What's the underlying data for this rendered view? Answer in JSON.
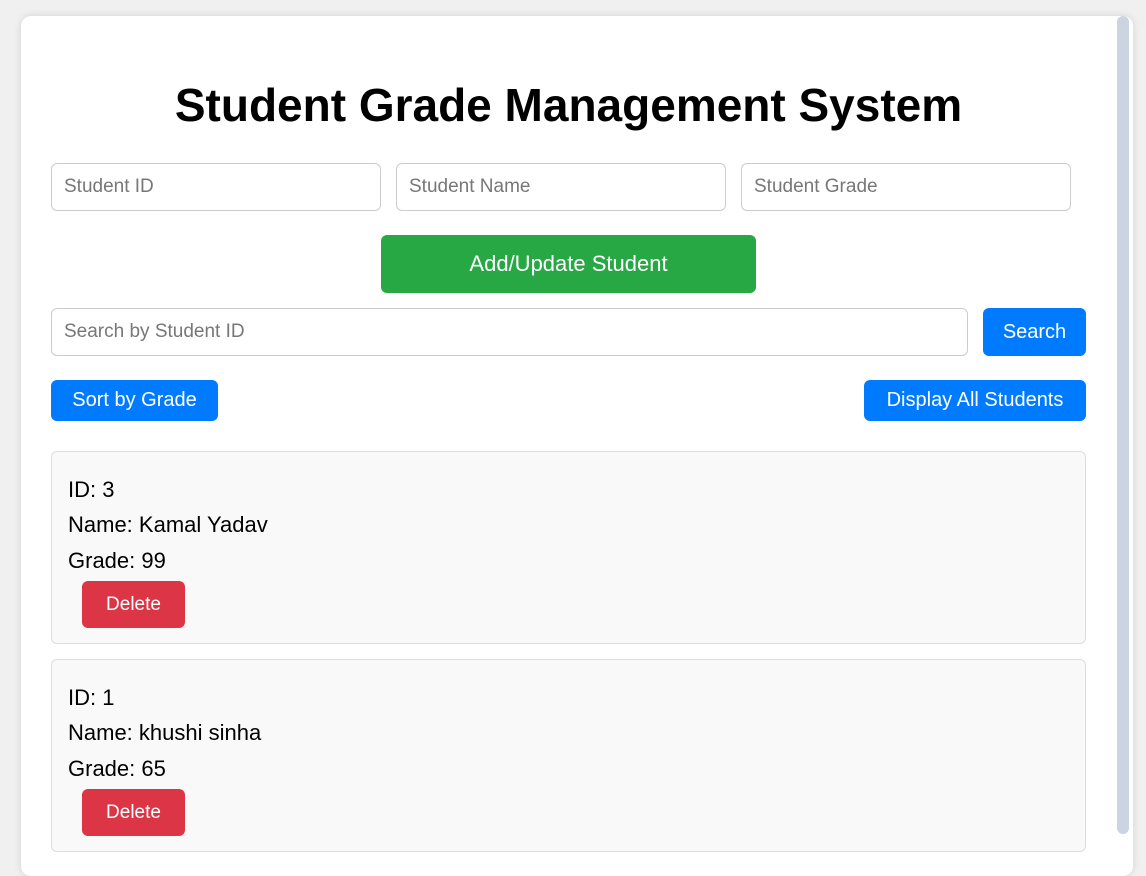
{
  "app": {
    "title": "Student Grade Management System"
  },
  "form": {
    "id_placeholder": "Student ID",
    "name_placeholder": "Student Name",
    "grade_placeholder": "Student Grade",
    "submit_label": "Add/Update Student"
  },
  "search": {
    "placeholder": "Search by Student ID",
    "button_label": "Search"
  },
  "actions": {
    "sort_label": "Sort by Grade",
    "display_all_label": "Display All Students"
  },
  "students": [
    {
      "id_text": "ID: 3",
      "name_text": "Name: Kamal Yadav",
      "grade_text": "Grade: 99",
      "delete_label": "Delete"
    },
    {
      "id_text": "ID: 1",
      "name_text": "Name: khushi sinha",
      "grade_text": "Grade: 65",
      "delete_label": "Delete"
    }
  ],
  "colors": {
    "green": "#28a745",
    "blue": "#007bff",
    "red": "#dc3545"
  }
}
